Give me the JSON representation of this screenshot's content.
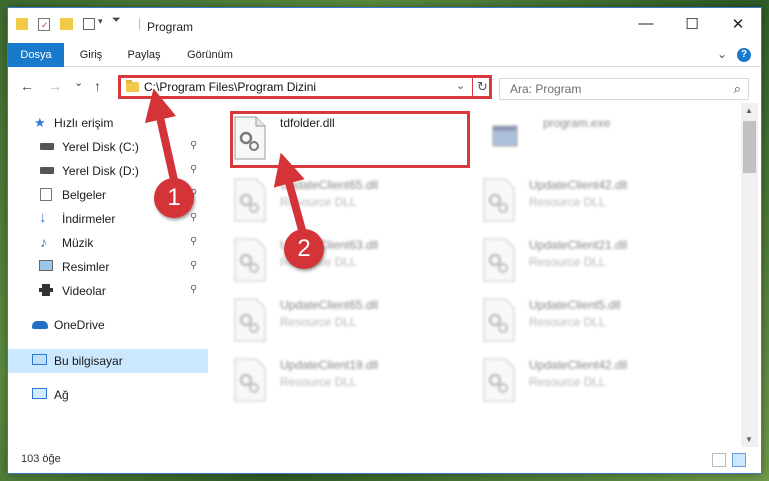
{
  "window": {
    "title": "Program",
    "controls": {
      "minimize": "—",
      "maximize": "☐",
      "close": "✕"
    }
  },
  "ribbon": {
    "tabs": [
      "Dosya",
      "Giriş",
      "Paylaş",
      "Görünüm"
    ],
    "active_tab": "Dosya",
    "expand_icon": "⌄",
    "help_icon": "?"
  },
  "navigation": {
    "back_icon": "←",
    "forward_icon": "→",
    "recent_icon": "⌄",
    "up_icon": "↑",
    "address": "C:\\Program Files\\Program Dizini",
    "address_dropdown": "⌄",
    "refresh_icon": "↻",
    "search_placeholder": "Ara: Program",
    "search_icon": "⌕"
  },
  "sidebar": {
    "items": [
      {
        "label": "Hızlı erişim",
        "icon": "star-icon",
        "pinned": false
      },
      {
        "label": "Yerel Disk (C:)",
        "icon": "drive-icon",
        "pinned": true
      },
      {
        "label": "Yerel Disk (D:)",
        "icon": "drive-icon",
        "pinned": true
      },
      {
        "label": "Belgeler",
        "icon": "documents-icon",
        "pinned": true
      },
      {
        "label": "İndirmeler",
        "icon": "download-icon",
        "pinned": true
      },
      {
        "label": "Müzik",
        "icon": "music-icon",
        "pinned": true
      },
      {
        "label": "Resimler",
        "icon": "pictures-icon",
        "pinned": true
      },
      {
        "label": "Videolar",
        "icon": "video-icon",
        "pinned": true
      },
      {
        "label": "OneDrive",
        "icon": "cloud-icon",
        "pinned": false
      },
      {
        "label": "Bu bilgisayar",
        "icon": "computer-icon",
        "pinned": false
      },
      {
        "label": "Ağ",
        "icon": "network-icon",
        "pinned": false
      }
    ],
    "pin_glyph": "📌"
  },
  "files": [
    {
      "name": "tdfolder.dll",
      "type": "",
      "highlighted": true
    },
    {
      "name": "program.exe",
      "type": ""
    },
    {
      "name": "UpdateClient65.dll",
      "type": "Resource DLL"
    },
    {
      "name": "UpdateClient42.dll",
      "type": "Resource DLL"
    },
    {
      "name": "UpdateClient63.dll",
      "type": "Resource DLL"
    },
    {
      "name": "UpdateClient21.dll",
      "type": "Resource DLL"
    },
    {
      "name": "UpdateClient65.dll",
      "type": "Resource DLL"
    },
    {
      "name": "UpdateClient5.dll",
      "type": "Resource DLL"
    },
    {
      "name": "UpdateClient19.dll",
      "type": "Resource DLL"
    },
    {
      "name": "UpdateClient42.dll",
      "type": "Resource DLL"
    }
  ],
  "status": {
    "item_count": "103 öğe"
  },
  "callouts": [
    "1",
    "2"
  ],
  "colors": {
    "accent": "#1979ca",
    "annotation_red": "#d9393d",
    "selection": "#cce8ff"
  }
}
